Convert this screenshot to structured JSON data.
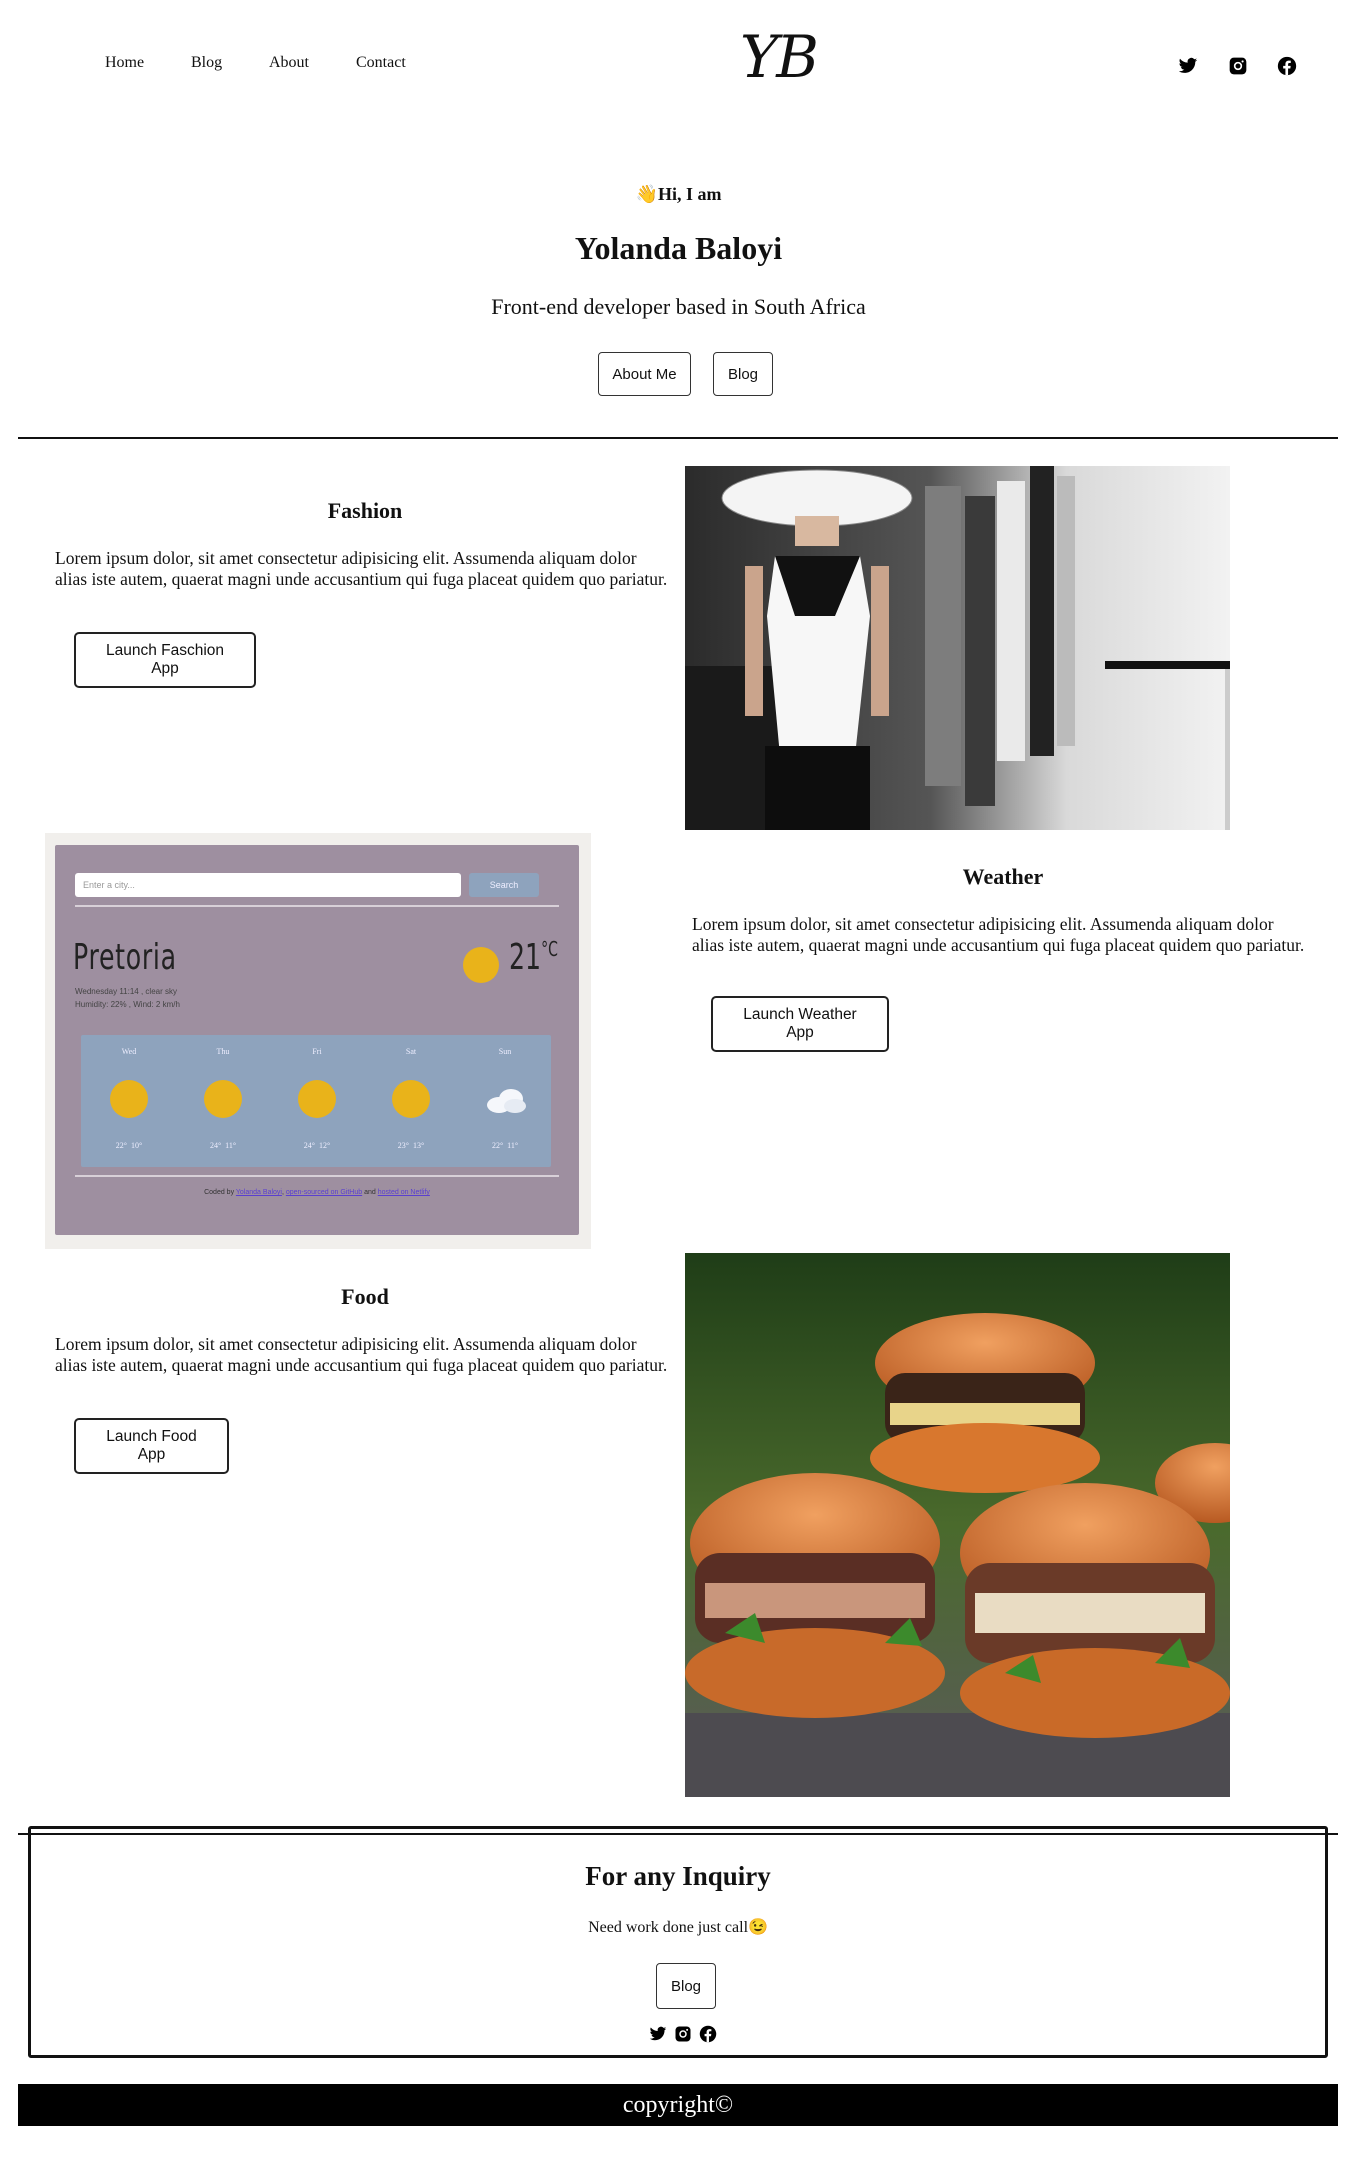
{
  "nav": {
    "links": [
      "Home",
      "Blog",
      "About",
      "Contact"
    ],
    "logo": "YB",
    "social_icons": [
      "twitter-icon",
      "instagram-icon",
      "facebook-icon"
    ]
  },
  "hero": {
    "wave_emoji": "👋",
    "greeting": "Hi, I am",
    "name": "Yolanda Baloyi",
    "subtitle": "Front-end developer based in South Africa",
    "buttons": [
      "About Me",
      "Blog"
    ]
  },
  "projects": [
    {
      "title": "Fashion",
      "text": "Lorem ipsum dolor, sit amet consectetur adipisicing elit. Assumenda aliquam dolor alias iste autem, quaerat magni unde accusantium qui fuga placeat quidem quo pariatur.",
      "button": "Launch Faschion App"
    },
    {
      "title": "Weather",
      "text": "Lorem ipsum dolor, sit amet consectetur adipisicing elit. Assumenda aliquam dolor alias iste autem, quaerat magni unde accusantium qui fuga placeat quidem quo pariatur.",
      "button": "Launch Weather App"
    },
    {
      "title": "Food",
      "text": "Lorem ipsum dolor, sit amet consectetur adipisicing elit. Assumenda aliquam dolor alias iste autem, quaerat magni unde accusantium qui fuga placeat quidem quo pariatur.",
      "button": "Launch Food App"
    }
  ],
  "weather_preview": {
    "search_placeholder": "Enter a city...",
    "search_button": "Search",
    "city": "Pretoria",
    "temperature": "21",
    "unit": "°C",
    "details_line1": "Wednesday 11:14 , clear sky",
    "details_line2": "Humidity: 22% , Wind: 2 km/h",
    "forecast": [
      {
        "day": "Wed",
        "high": "22°",
        "low": "10°",
        "icon": "sun-icon"
      },
      {
        "day": "Thu",
        "high": "24°",
        "low": "11°",
        "icon": "sun-icon"
      },
      {
        "day": "Fri",
        "high": "24°",
        "low": "12°",
        "icon": "sun-icon"
      },
      {
        "day": "Sat",
        "high": "23°",
        "low": "13°",
        "icon": "sun-icon"
      },
      {
        "day": "Sun",
        "high": "22°",
        "low": "11°",
        "icon": "cloud-icon"
      }
    ],
    "credit_prefix": "Coded by",
    "credit_author": "Yolanda Baloyi",
    "credit_link1": "open-sourced on GitHub",
    "credit_mid": "and",
    "credit_link2": "hosted on Netlify"
  },
  "inquiry": {
    "title": "For any Inquiry",
    "text": "Need work done just call",
    "emoji": "😉",
    "button": "Blog"
  },
  "footer": {
    "copyright": "copyright©"
  },
  "colors": {
    "weather_bg": "#9e8fa0",
    "weather_panel": "#8ea3bd",
    "sun": "#e9b31a"
  }
}
